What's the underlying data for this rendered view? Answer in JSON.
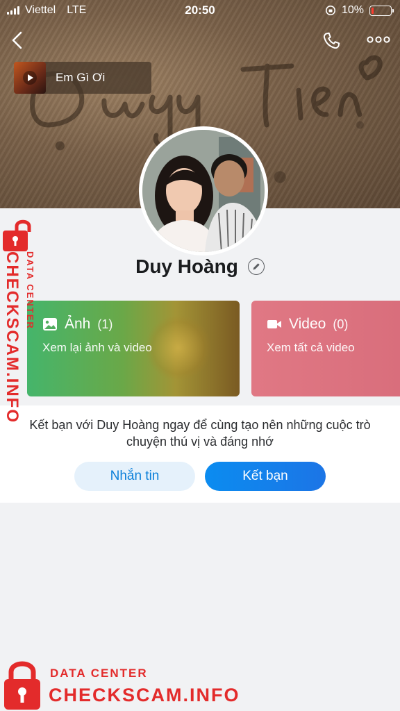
{
  "status_bar": {
    "carrier": "Viettel",
    "network": "LTE",
    "time": "20:50",
    "battery": "10%",
    "battery_level": 0.1,
    "battery_color": "#ff3b30"
  },
  "header": {
    "back_icon": "chevron-left-icon",
    "call_icon": "phone-icon",
    "more_icon": "ellipsis-icon"
  },
  "music": {
    "title": "Em Gì Ơi",
    "icon": "play-icon"
  },
  "profile": {
    "name": "Duy Hoàng",
    "edit_icon": "pencil-icon"
  },
  "cards": {
    "photos": {
      "title": "Ảnh",
      "count": "(1)",
      "subtitle": "Xem lại ảnh và video",
      "icon": "image-icon"
    },
    "videos": {
      "title": "Video",
      "count": "(0)",
      "subtitle": "Xem tất cả video",
      "icon": "video-camera-icon"
    }
  },
  "friend_prompt": {
    "text": "Kết bạn với Duy Hoàng ngay để cùng tạo nên những cuộc trò chuyện thú vị và đáng nhớ",
    "message_button": "Nhắn tin",
    "add_friend_button": "Kết bạn"
  },
  "colors": {
    "accent": "#0b8cf0",
    "watermark": "#e32b2b"
  },
  "watermark": {
    "line1": "DATA CENTER",
    "line2": "CHECKSCAM.INFO"
  }
}
